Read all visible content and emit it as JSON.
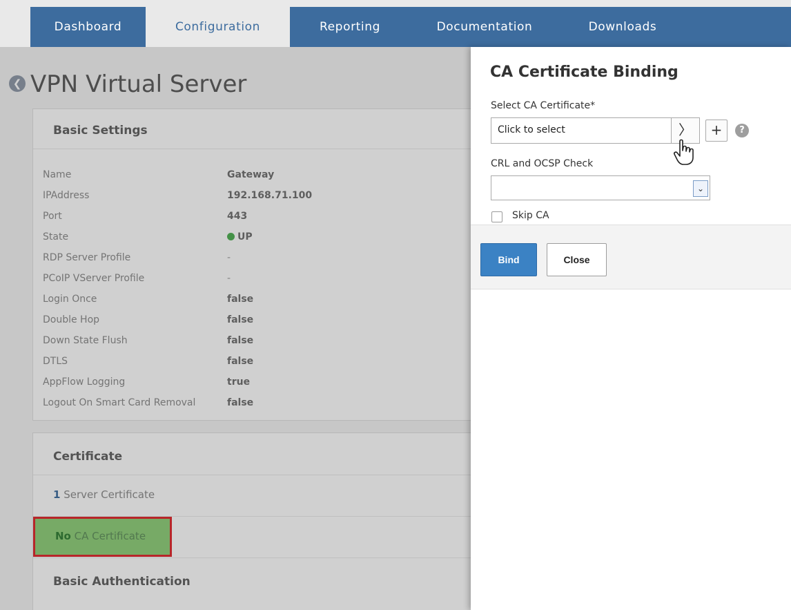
{
  "nav": {
    "tabs": [
      {
        "label": "Dashboard"
      },
      {
        "label": "Configuration"
      },
      {
        "label": "Reporting"
      },
      {
        "label": "Documentation"
      },
      {
        "label": "Downloads"
      }
    ]
  },
  "page": {
    "title": "VPN Virtual Server",
    "basic_settings": {
      "heading": "Basic Settings",
      "rows": [
        {
          "key": "Name",
          "value": "Gateway"
        },
        {
          "key": "IPAddress",
          "value": "192.168.71.100"
        },
        {
          "key": "Port",
          "value": "443"
        },
        {
          "key": "State",
          "value": "UP"
        },
        {
          "key": "RDP Server Profile",
          "value": "-"
        },
        {
          "key": "PCoIP VServer Profile",
          "value": "-"
        },
        {
          "key": "Login Once",
          "value": "false"
        },
        {
          "key": "Double Hop",
          "value": "false"
        },
        {
          "key": "Down State Flush",
          "value": "false"
        },
        {
          "key": "DTLS",
          "value": "false"
        },
        {
          "key": "AppFlow Logging",
          "value": "true"
        },
        {
          "key": "Logout On Smart Card Removal",
          "value": "false"
        }
      ]
    },
    "certificate": {
      "heading": "Certificate",
      "server_count": "1",
      "server_label": " Server Certificate",
      "ca_count": "No",
      "ca_label": " CA Certificate"
    },
    "basic_auth_heading": "Basic Authentication"
  },
  "dialog": {
    "title": "CA Certificate Binding",
    "select_label": "Select CA Certificate*",
    "select_value": "Click to select",
    "crl_label": "CRL and OCSP Check",
    "crl_value": "",
    "skip_ca_label": "Skip CA",
    "bind_label": "Bind",
    "close_label": "Close"
  },
  "icons": {
    "back": "back-arrow-icon",
    "chevron": "chevron-right-icon",
    "add": "plus-icon",
    "help": "help-icon",
    "dropdown": "chevron-down-icon",
    "cursor": "hand-pointer-icon"
  },
  "colors": {
    "nav_bg": "#3d6c9e",
    "primary_button": "#3b82c4",
    "highlight_border": "#e0252a",
    "highlight_fill": "#8ecf78",
    "state_up": "#4caf50"
  }
}
